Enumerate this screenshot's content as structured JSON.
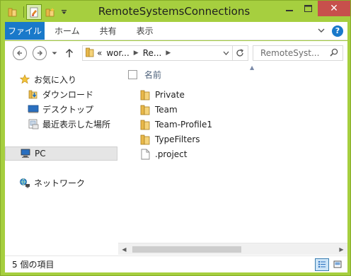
{
  "window": {
    "title": "RemoteSystemsConnections",
    "accent_color": "#a6cf3f",
    "close_color": "#c7504c"
  },
  "qat": {
    "icons": [
      "folder-icon",
      "properties-icon",
      "new-folder-icon",
      "qat-dropdown-icon"
    ]
  },
  "ribbon": {
    "file_tab": "ファイル",
    "tabs": [
      "ホーム",
      "共有",
      "表示"
    ],
    "file_tab_color": "#1979ca"
  },
  "address": {
    "crumbs": [
      "wor...",
      "Re..."
    ],
    "overflow": "«",
    "search_placeholder": "RemoteSyst..."
  },
  "nav_pane": {
    "favorites": "お気に入り",
    "downloads": "ダウンロード",
    "desktop": "デスクトップ",
    "recent": "最近表示した場所",
    "pc": "PC",
    "network": "ネットワーク"
  },
  "file_list": {
    "column_name": "名前",
    "items": [
      {
        "name": "Private",
        "type": "folder"
      },
      {
        "name": "Team",
        "type": "folder"
      },
      {
        "name": "Team-Profile1",
        "type": "folder"
      },
      {
        "name": "TypeFilters",
        "type": "folder"
      },
      {
        "name": ".project",
        "type": "file"
      }
    ]
  },
  "status": {
    "item_count": "5 個の項目"
  }
}
